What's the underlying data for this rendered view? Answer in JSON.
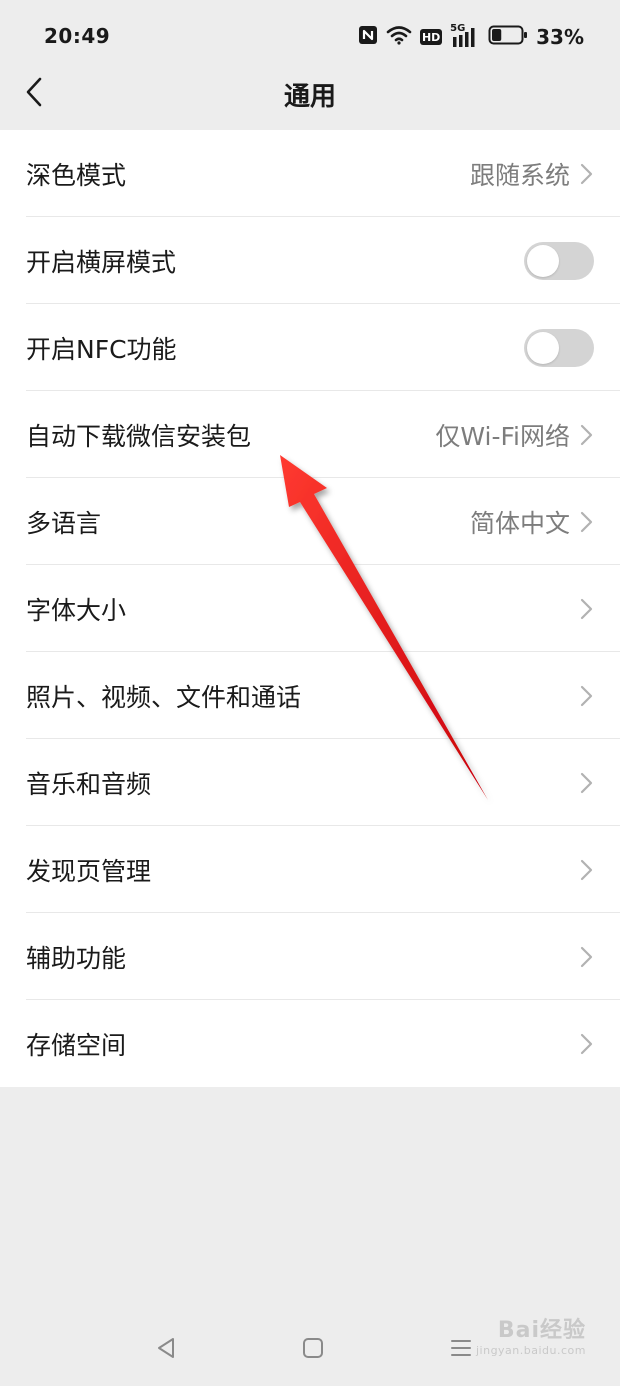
{
  "status_bar": {
    "time": "20:49",
    "network_label": "5G",
    "hd_label": "HD",
    "battery_percent": "33%",
    "battery_level": 0.33
  },
  "nav": {
    "title": "通用"
  },
  "settings": [
    {
      "label": "深色模式",
      "value": "跟随系统",
      "control": "chevron"
    },
    {
      "label": "开启横屏模式",
      "value": "",
      "control": "toggle",
      "on": false
    },
    {
      "label": "开启NFC功能",
      "value": "",
      "control": "toggle",
      "on": false
    },
    {
      "label": "自动下载微信安装包",
      "value": "仅Wi-Fi网络",
      "control": "chevron"
    },
    {
      "label": "多语言",
      "value": "简体中文",
      "control": "chevron"
    },
    {
      "label": "字体大小",
      "value": "",
      "control": "chevron"
    },
    {
      "label": "照片、视频、文件和通话",
      "value": "",
      "control": "chevron"
    },
    {
      "label": "音乐和音频",
      "value": "",
      "control": "chevron"
    },
    {
      "label": "发现页管理",
      "value": "",
      "control": "chevron"
    },
    {
      "label": "辅助功能",
      "value": "",
      "control": "chevron"
    },
    {
      "label": "存储空间",
      "value": "",
      "control": "chevron"
    }
  ],
  "watermark": {
    "brand": "Bai经验",
    "url": "jingyan.baidu.com"
  },
  "colors": {
    "background": "#ededed",
    "row_background": "#ffffff",
    "toggle_off": "#d4d4d4",
    "annotation_arrow": "#e8141c"
  },
  "icons": {
    "back": "chevron-left-icon",
    "row_arrow": "chevron-right-icon",
    "nfc": "nfc-icon",
    "wifi": "wifi-icon",
    "signal": "signal-icon",
    "battery": "battery-icon",
    "annotation": "red-arrow-icon"
  }
}
